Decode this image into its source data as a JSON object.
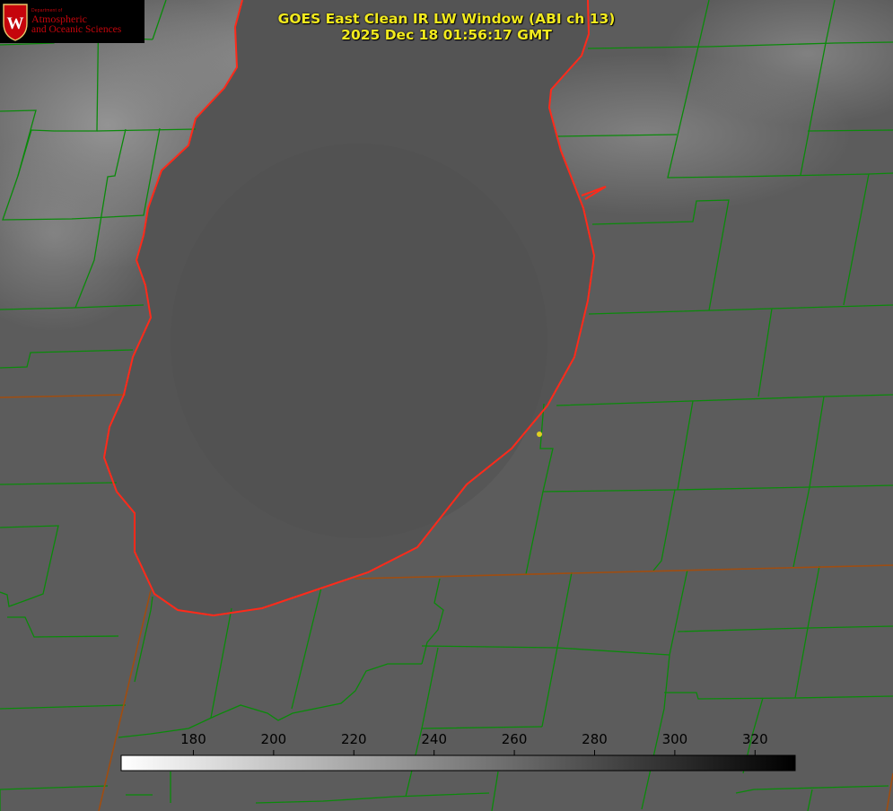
{
  "title": {
    "line1": "GOES East Clean IR LW Window (ABI ch 13)",
    "line2": "2025 Dec 18 01:56:17 GMT"
  },
  "logo": {
    "department_label": "Department of",
    "line1": "Atmospheric",
    "line2": "and Oceanic Sciences",
    "seal_icon": "uw-crest-icon"
  },
  "colorbar": {
    "tick_labels": [
      "180",
      "200",
      "220",
      "240",
      "260",
      "280",
      "300",
      "320"
    ],
    "ticks": [
      180,
      200,
      220,
      240,
      260,
      280,
      300,
      320
    ],
    "range": [
      162,
      330
    ],
    "gradient": [
      "#ffffff",
      "#000000"
    ]
  },
  "colors": {
    "background": "#5c5c5c",
    "lake": "#545454",
    "county_lines": "#0a8a0a",
    "state_lines": "#a04d10",
    "shoreline": "#ff2a1a",
    "marker": "#e0d020",
    "title_text": "#f2ea1e",
    "logo_text": "#c5050c"
  }
}
